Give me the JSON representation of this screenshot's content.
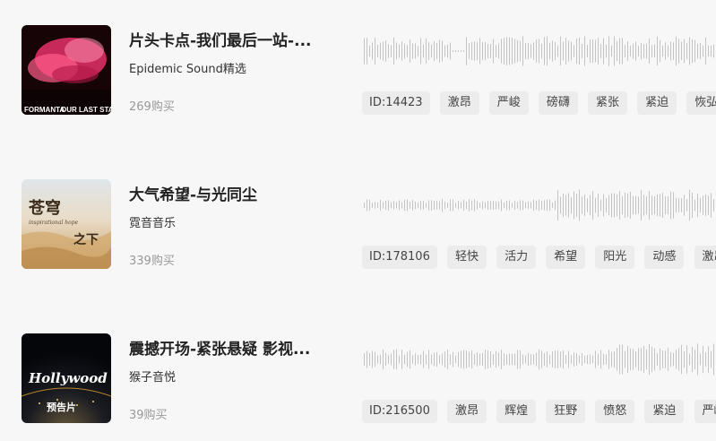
{
  "tracks": [
    {
      "title": "片头卡点-我们最后一站-...",
      "artist": "Epidemic Sound精选",
      "purchases": "269购买",
      "id_label": "ID:14423",
      "tags": [
        "激昂",
        "严峻",
        "磅礴",
        "紧张",
        "紧迫",
        "恢弘"
      ],
      "cover": {
        "line1": "FORMANTA",
        "line2": "OUR LAST STAND",
        "accent": "#e8306a",
        "bg": "#1a0508"
      }
    },
    {
      "title": "大气希望-与光同尘",
      "artist": "霓音音乐",
      "purchases": "339购买",
      "id_label": "ID:178106",
      "tags": [
        "轻快",
        "活力",
        "希望",
        "阳光",
        "动感",
        "激昂"
      ],
      "cover": {
        "line1": "苍穹",
        "line2": "inspirational hope",
        "line3": "之下",
        "accent": "#c89a5a",
        "bg": "#e6d6bf"
      }
    },
    {
      "title": "震撼开场-紧张悬疑 影视...",
      "artist": "猴子音悦",
      "purchases": "39购买",
      "id_label": "ID:216500",
      "tags": [
        "激昂",
        "辉煌",
        "狂野",
        "愤怒",
        "紧迫",
        "严峻"
      ],
      "cover": {
        "line1": "Hollywood",
        "line2": "预告片",
        "accent": "#e0a030",
        "bg": "#05070c"
      }
    }
  ]
}
